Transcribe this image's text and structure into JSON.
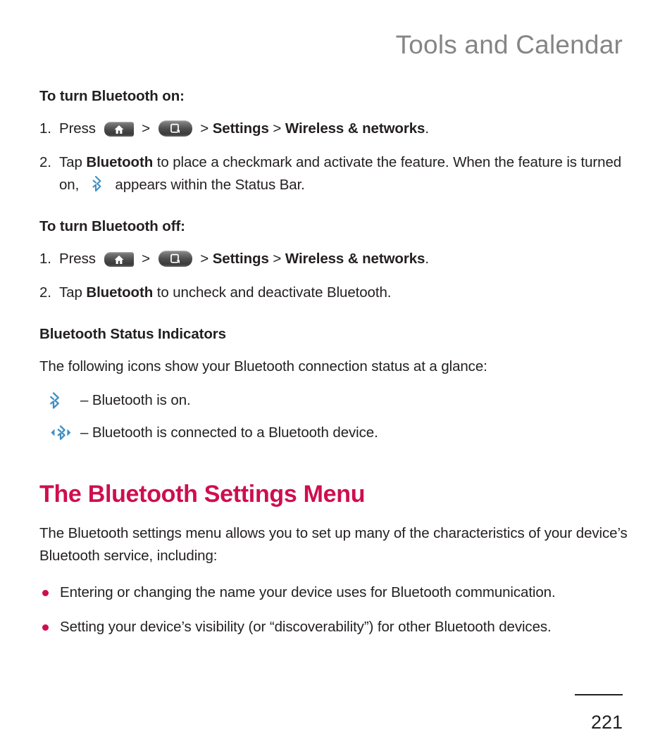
{
  "header": {
    "running_title": "Tools and Calendar"
  },
  "sections": {
    "turn_on": {
      "subhead": "To turn Bluetooth on:",
      "steps": [
        {
          "number": "1.",
          "lead": "Press",
          "sep1": ">",
          "sep2": ">",
          "settings": "Settings",
          "sep3": ">",
          "wireless": "Wireless & networks",
          "period": "."
        },
        {
          "number": "2.",
          "text_before": "Tap",
          "bold_term": "Bluetooth",
          "text_mid": "to place a checkmark and activate the feature. When the feature is turned on,",
          "text_after": "appears within the Status Bar."
        }
      ]
    },
    "turn_off": {
      "subhead": "To turn Bluetooth off:",
      "steps": [
        {
          "number": "1.",
          "lead": "Press",
          "sep1": ">",
          "sep2": ">",
          "settings": "Settings",
          "sep3": ">",
          "wireless": "Wireless & networks",
          "period": "."
        },
        {
          "number": "2.",
          "text_before": "Tap",
          "bold_term": "Bluetooth",
          "text_after": "to uncheck and deactivate Bluetooth."
        }
      ]
    },
    "status_indicators": {
      "subhead": "Bluetooth Status Indicators",
      "intro": "The following icons show your Bluetooth connection status at a glance:",
      "items": [
        {
          "icon": "bluetooth-on-icon",
          "text": "– Bluetooth is on."
        },
        {
          "icon": "bluetooth-connected-icon",
          "text": "– Bluetooth is connected to a Bluetooth device."
        }
      ]
    },
    "settings_menu": {
      "heading": "The Bluetooth Settings Menu",
      "intro": "The Bluetooth settings menu allows you to set up many of the characteristics of your device’s Bluetooth service, including:",
      "bullets": [
        "Entering or changing the name your device uses for Bluetooth communication.",
        "Setting your device’s visibility (or “discoverability”) for other Bluetooth devices."
      ]
    }
  },
  "footer": {
    "page_number": "221"
  },
  "colors": {
    "accent": "#ce0e4e",
    "header_gray": "#858585",
    "body": "#231f20",
    "bluetooth_blue": "#3f8fc4"
  }
}
